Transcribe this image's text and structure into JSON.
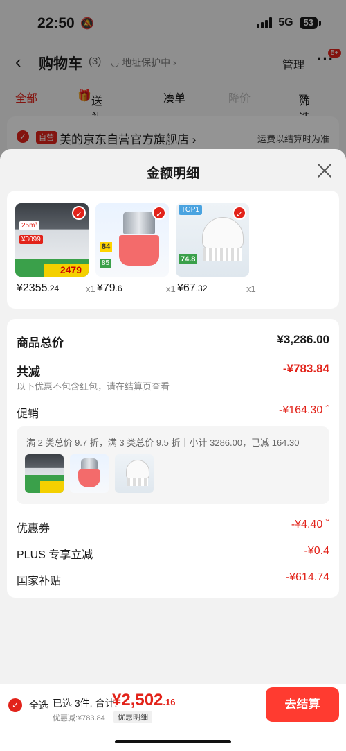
{
  "status_bar": {
    "time": "22:50",
    "network": "5G",
    "battery": "53"
  },
  "nav": {
    "title": "购物车",
    "count": "(3)",
    "address_protect": "地址保护中",
    "manage": "管理",
    "more": "···",
    "more_badge": "5+"
  },
  "filters": {
    "all": "全部",
    "gift": "送礼",
    "order_together": "凑单",
    "price_drop": "降价",
    "filter": "筛选"
  },
  "store": {
    "tag": "自营",
    "name": "美的京东自营官方旗舰店",
    "shipping": "运费以结算时为准"
  },
  "sheet": {
    "title": "金额明细",
    "products": [
      {
        "price_main": "¥2355",
        "price_dec": ".24",
        "qty": "x1",
        "img_badge": "2479"
      },
      {
        "price_main": "¥79",
        "price_dec": ".6",
        "qty": "x1",
        "img_badge": "84"
      },
      {
        "price_main": "¥67",
        "price_dec": ".32",
        "qty": "x1",
        "img_badge": "74.8"
      }
    ],
    "total_label": "商品总价",
    "total_value": "¥3,286.00",
    "reduce_label": "共减",
    "reduce_value": "-¥783.84",
    "note": "以下优惠不包含红包，请在结算页查看",
    "promo_label": "促销",
    "promo_value": "-¥164.30",
    "promo_detail": "满 2 类总价 9.7 折，满 3 类总价 9.5 折｜小计 3286.00，已减 164.30",
    "coupon_label": "优惠券",
    "coupon_value": "-¥4.40",
    "plus_label": "PLUS 专享立减",
    "plus_value": "-¥0.4",
    "subsidy_label": "国家补贴",
    "subsidy_value": "-¥614.74"
  },
  "bottom": {
    "select_all": "全选",
    "selected": "已选 3件, 合计:",
    "sum_main": "¥2,502",
    "sum_dec": ".16",
    "discount": "优惠减:¥783.84",
    "detail": "优惠明细",
    "checkout": "去结算"
  },
  "colors": {
    "accent": "#e2231a",
    "checkout": "#ff3b30"
  }
}
